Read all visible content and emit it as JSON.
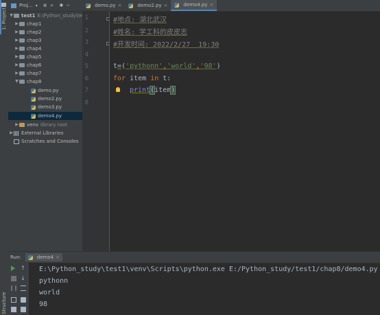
{
  "side_tabs": {
    "project": "1: Project",
    "structure": "Structure"
  },
  "project_panel": {
    "title": "Proj...",
    "root_name": "test1",
    "root_path": "E:\\Python_study\\te",
    "folders": [
      "chap1",
      "chap2",
      "chap3",
      "chap4",
      "chap5",
      "chap6",
      "chap7",
      "chap8"
    ],
    "chap8_files": [
      "demo.py",
      "demo2.py",
      "demo3.py",
      "demo4.py"
    ],
    "venv_name": "venv",
    "venv_note": "library root",
    "external_libraries": "External Libraries",
    "scratches": "Scratches and Consoles"
  },
  "tabs": [
    {
      "label": "demo.py",
      "active": false
    },
    {
      "label": "demo2.py",
      "active": false
    },
    {
      "label": "demo4.py",
      "active": true
    }
  ],
  "line_numbers": [
    "1",
    "2",
    "3",
    "4",
    "5",
    "6",
    "7",
    "8"
  ],
  "code": {
    "line1": "#地点: 湖北武汉",
    "line2": "#姓名: 学工科的皮皮志",
    "line3": "#开发时间: 2022/2/27  19:30",
    "line5_var": "t",
    "line5_eq": "=",
    "line5_open": "(",
    "line5_s1": "'pythonn'",
    "line5_c1": ",",
    "line5_s2": "'world'",
    "line5_c2": ",",
    "line5_s3": "'98'",
    "line5_close": ")",
    "line6_kw1": "for",
    "line6_mid": " item ",
    "line6_kw2": "in",
    "line6_end": " t:",
    "line7_fn": "print",
    "line7_open": "(",
    "line7_arg": "item",
    "line7_close": ")"
  },
  "run_panel": {
    "label": "Run:",
    "config": "demo4",
    "output": [
      "E:\\Python_study\\test1\\venv\\Scripts\\python.exe E:/Python_study/test1/chap8/demo4.py",
      "pythonn",
      "world",
      "98"
    ]
  },
  "colors": {
    "run_green": "#499c54",
    "accent_blue": "#4a88c7",
    "bulb": "#f0c040"
  }
}
